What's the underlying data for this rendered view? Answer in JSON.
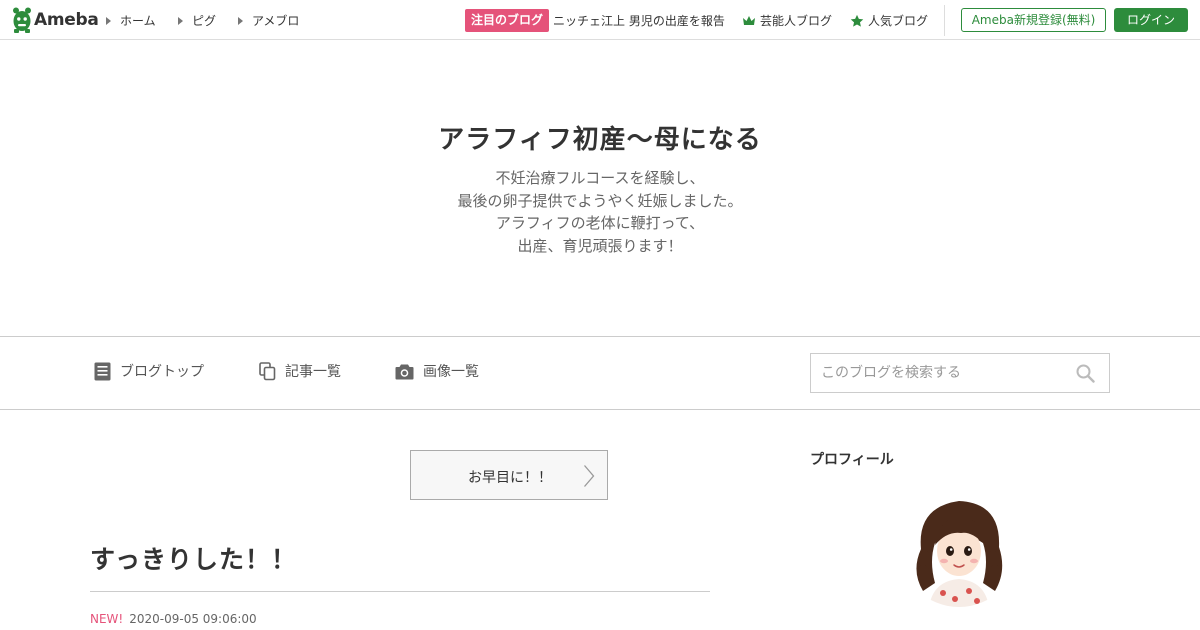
{
  "header": {
    "logo_text": "Ameba",
    "nav": [
      "ホーム",
      "ピグ",
      "アメブロ"
    ],
    "featured_badge": "注目のブログ",
    "featured_headline": "ニッチェ江上 男児の出産を報告",
    "celebrity_blog": "芸能人ブログ",
    "popular_blog": "人気ブログ",
    "register_button": "Ameba新規登録(無料)",
    "login_button": "ログイン",
    "colors": {
      "brand_green": "#2d8c3c",
      "accent_pink": "#e5537a"
    }
  },
  "blog": {
    "title": "アラフィフ初産～母になる",
    "description": [
      "不妊治療フルコースを経験し、",
      "最後の卵子提供でようやく妊娠しました。",
      "アラフィフの老体に鞭打って、",
      "出産、育児頑張ります！"
    ]
  },
  "blog_nav": {
    "items": [
      {
        "label": "ブログトップ",
        "icon": "document-icon"
      },
      {
        "label": "記事一覧",
        "icon": "copy-icon"
      },
      {
        "label": "画像一覧",
        "icon": "camera-icon"
      }
    ],
    "search_placeholder": "このブログを検索する"
  },
  "entry_nav": {
    "prev_label": "お早目に！！"
  },
  "entry": {
    "title": "すっきりした！！",
    "new_label": "NEW!",
    "datetime": "2020-09-05 09:06:00"
  },
  "sidebar": {
    "profile_heading": "プロフィール"
  }
}
